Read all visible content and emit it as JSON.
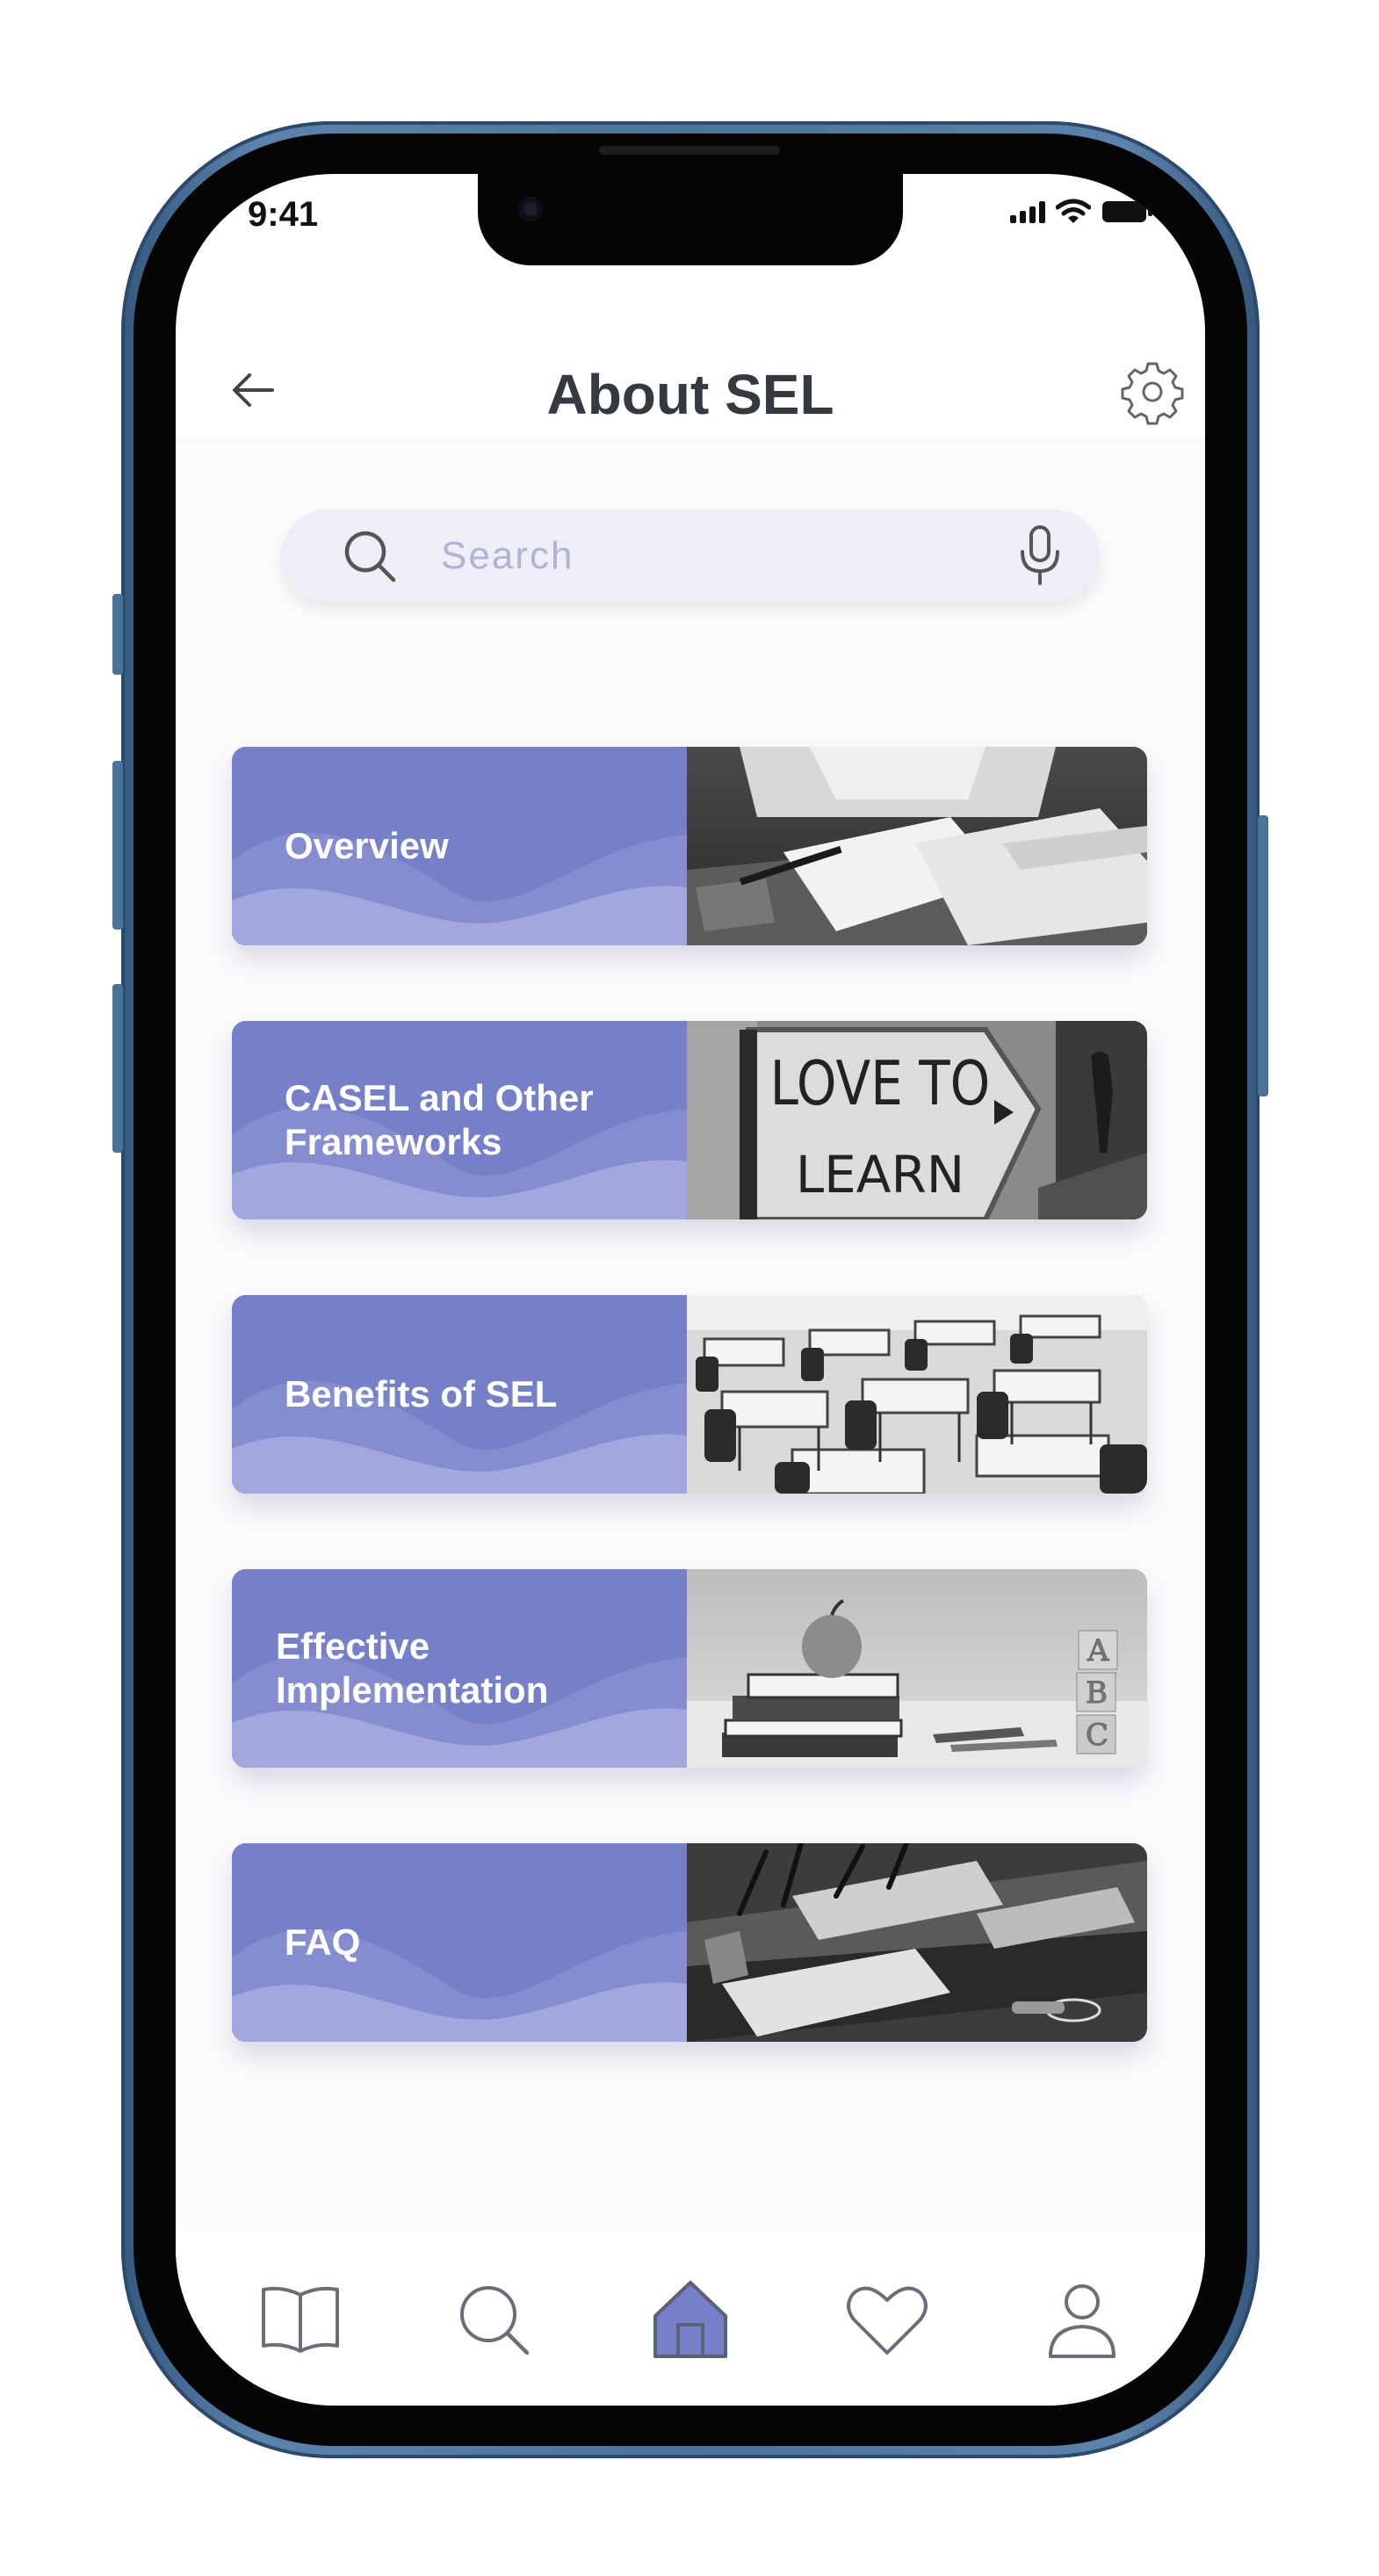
{
  "status_bar": {
    "time": "9:41"
  },
  "header": {
    "title": "About SEL"
  },
  "search": {
    "placeholder": "Search"
  },
  "cards": [
    {
      "label": "Overview",
      "image": "student-writing-with-book-photo"
    },
    {
      "label": "CASEL and Other\nFrameworks",
      "image": "love-to-learn-sign-photo"
    },
    {
      "label": "Benefits of SEL",
      "image": "classroom-desks-photo"
    },
    {
      "label": "Effective\nImplementation",
      "image": "apple-books-abc-blocks-photo"
    },
    {
      "label": "FAQ",
      "image": "school-supplies-drawer-photo"
    }
  ],
  "bottom_nav": {
    "items": [
      "book-icon",
      "search-icon",
      "home-icon",
      "heart-icon",
      "user-icon"
    ],
    "active": "home-icon"
  },
  "colors": {
    "card_primary": "#7680c8",
    "card_wave": "#9aa1d8",
    "nav_active": "#7680c8",
    "icon_gray": "#6b6e78",
    "title": "#343a40"
  }
}
